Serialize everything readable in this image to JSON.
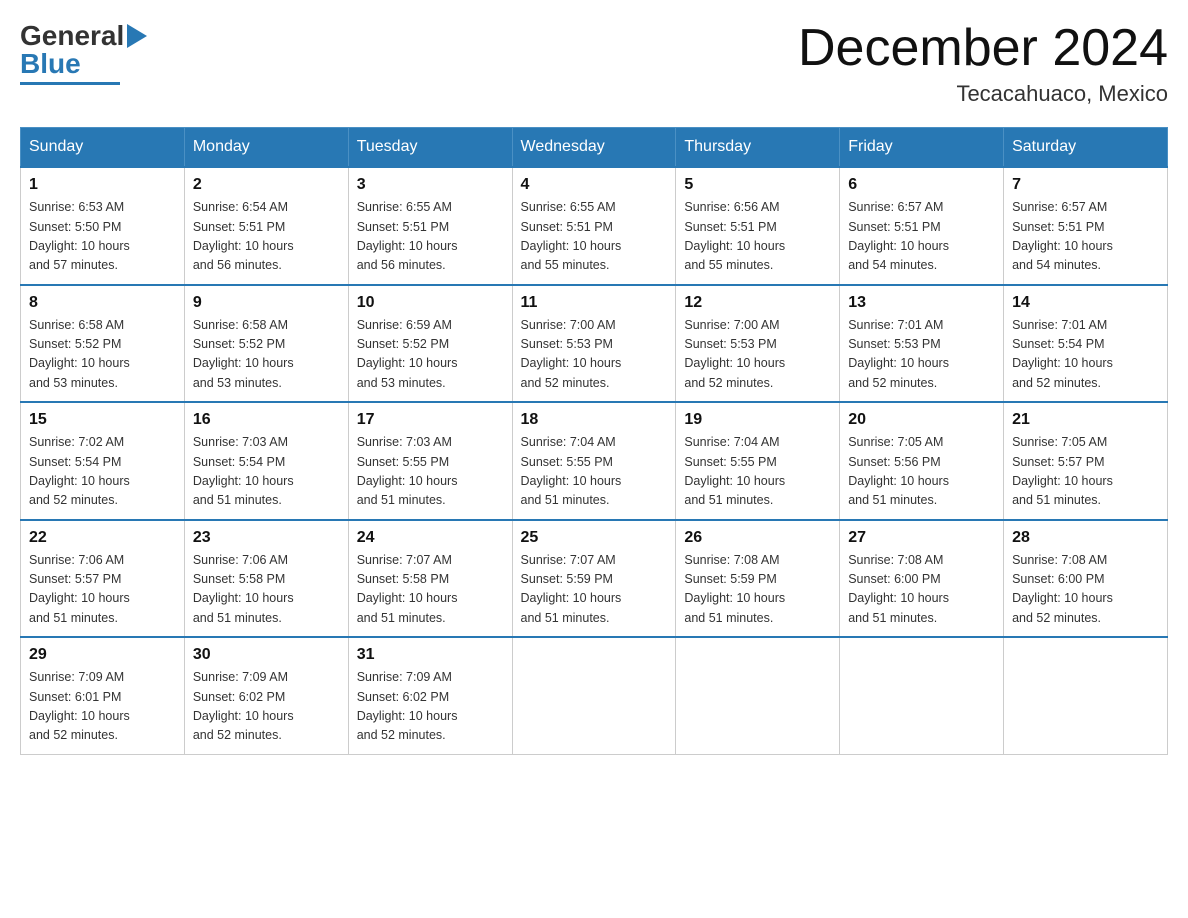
{
  "header": {
    "logo_general": "General",
    "logo_blue": "Blue",
    "month_title": "December 2024",
    "location": "Tecacahuaco, Mexico"
  },
  "days_of_week": [
    "Sunday",
    "Monday",
    "Tuesday",
    "Wednesday",
    "Thursday",
    "Friday",
    "Saturday"
  ],
  "weeks": [
    [
      {
        "day": "1",
        "sunrise": "6:53 AM",
        "sunset": "5:50 PM",
        "daylight": "10 hours and 57 minutes."
      },
      {
        "day": "2",
        "sunrise": "6:54 AM",
        "sunset": "5:51 PM",
        "daylight": "10 hours and 56 minutes."
      },
      {
        "day": "3",
        "sunrise": "6:55 AM",
        "sunset": "5:51 PM",
        "daylight": "10 hours and 56 minutes."
      },
      {
        "day": "4",
        "sunrise": "6:55 AM",
        "sunset": "5:51 PM",
        "daylight": "10 hours and 55 minutes."
      },
      {
        "day": "5",
        "sunrise": "6:56 AM",
        "sunset": "5:51 PM",
        "daylight": "10 hours and 55 minutes."
      },
      {
        "day": "6",
        "sunrise": "6:57 AM",
        "sunset": "5:51 PM",
        "daylight": "10 hours and 54 minutes."
      },
      {
        "day": "7",
        "sunrise": "6:57 AM",
        "sunset": "5:51 PM",
        "daylight": "10 hours and 54 minutes."
      }
    ],
    [
      {
        "day": "8",
        "sunrise": "6:58 AM",
        "sunset": "5:52 PM",
        "daylight": "10 hours and 53 minutes."
      },
      {
        "day": "9",
        "sunrise": "6:58 AM",
        "sunset": "5:52 PM",
        "daylight": "10 hours and 53 minutes."
      },
      {
        "day": "10",
        "sunrise": "6:59 AM",
        "sunset": "5:52 PM",
        "daylight": "10 hours and 53 minutes."
      },
      {
        "day": "11",
        "sunrise": "7:00 AM",
        "sunset": "5:53 PM",
        "daylight": "10 hours and 52 minutes."
      },
      {
        "day": "12",
        "sunrise": "7:00 AM",
        "sunset": "5:53 PM",
        "daylight": "10 hours and 52 minutes."
      },
      {
        "day": "13",
        "sunrise": "7:01 AM",
        "sunset": "5:53 PM",
        "daylight": "10 hours and 52 minutes."
      },
      {
        "day": "14",
        "sunrise": "7:01 AM",
        "sunset": "5:54 PM",
        "daylight": "10 hours and 52 minutes."
      }
    ],
    [
      {
        "day": "15",
        "sunrise": "7:02 AM",
        "sunset": "5:54 PM",
        "daylight": "10 hours and 52 minutes."
      },
      {
        "day": "16",
        "sunrise": "7:03 AM",
        "sunset": "5:54 PM",
        "daylight": "10 hours and 51 minutes."
      },
      {
        "day": "17",
        "sunrise": "7:03 AM",
        "sunset": "5:55 PM",
        "daylight": "10 hours and 51 minutes."
      },
      {
        "day": "18",
        "sunrise": "7:04 AM",
        "sunset": "5:55 PM",
        "daylight": "10 hours and 51 minutes."
      },
      {
        "day": "19",
        "sunrise": "7:04 AM",
        "sunset": "5:55 PM",
        "daylight": "10 hours and 51 minutes."
      },
      {
        "day": "20",
        "sunrise": "7:05 AM",
        "sunset": "5:56 PM",
        "daylight": "10 hours and 51 minutes."
      },
      {
        "day": "21",
        "sunrise": "7:05 AM",
        "sunset": "5:57 PM",
        "daylight": "10 hours and 51 minutes."
      }
    ],
    [
      {
        "day": "22",
        "sunrise": "7:06 AM",
        "sunset": "5:57 PM",
        "daylight": "10 hours and 51 minutes."
      },
      {
        "day": "23",
        "sunrise": "7:06 AM",
        "sunset": "5:58 PM",
        "daylight": "10 hours and 51 minutes."
      },
      {
        "day": "24",
        "sunrise": "7:07 AM",
        "sunset": "5:58 PM",
        "daylight": "10 hours and 51 minutes."
      },
      {
        "day": "25",
        "sunrise": "7:07 AM",
        "sunset": "5:59 PM",
        "daylight": "10 hours and 51 minutes."
      },
      {
        "day": "26",
        "sunrise": "7:08 AM",
        "sunset": "5:59 PM",
        "daylight": "10 hours and 51 minutes."
      },
      {
        "day": "27",
        "sunrise": "7:08 AM",
        "sunset": "6:00 PM",
        "daylight": "10 hours and 51 minutes."
      },
      {
        "day": "28",
        "sunrise": "7:08 AM",
        "sunset": "6:00 PM",
        "daylight": "10 hours and 52 minutes."
      }
    ],
    [
      {
        "day": "29",
        "sunrise": "7:09 AM",
        "sunset": "6:01 PM",
        "daylight": "10 hours and 52 minutes."
      },
      {
        "day": "30",
        "sunrise": "7:09 AM",
        "sunset": "6:02 PM",
        "daylight": "10 hours and 52 minutes."
      },
      {
        "day": "31",
        "sunrise": "7:09 AM",
        "sunset": "6:02 PM",
        "daylight": "10 hours and 52 minutes."
      },
      null,
      null,
      null,
      null
    ]
  ]
}
